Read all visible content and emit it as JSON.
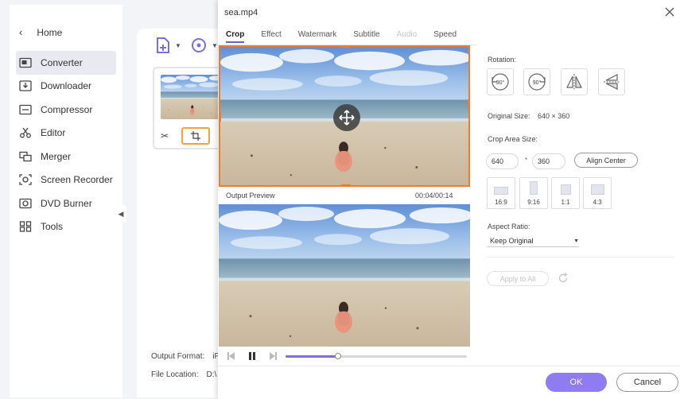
{
  "sidebar": {
    "home_label": "Home",
    "items": [
      {
        "label": "Converter",
        "icon": "converter-icon",
        "active": true
      },
      {
        "label": "Downloader",
        "icon": "downloader-icon"
      },
      {
        "label": "Compressor",
        "icon": "compressor-icon"
      },
      {
        "label": "Editor",
        "icon": "scissors-icon"
      },
      {
        "label": "Merger",
        "icon": "merger-icon"
      },
      {
        "label": "Screen Recorder",
        "icon": "screen-recorder-icon"
      },
      {
        "label": "DVD Burner",
        "icon": "dvd-icon"
      },
      {
        "label": "Tools",
        "icon": "tools-icon"
      }
    ]
  },
  "main": {
    "output_format_label": "Output Format:",
    "output_format_value": "iPa",
    "file_location_label": "File Location:",
    "file_location_value": "D:\\"
  },
  "dialog": {
    "title": "sea.mp4",
    "tabs": [
      {
        "label": "Crop",
        "state": "active"
      },
      {
        "label": "Effect",
        "state": "normal"
      },
      {
        "label": "Watermark",
        "state": "normal"
      },
      {
        "label": "Subtitle",
        "state": "normal"
      },
      {
        "label": "Audio",
        "state": "disabled"
      },
      {
        "label": "Speed",
        "state": "normal"
      }
    ],
    "output_preview_label": "Output Preview",
    "time": "00:04/00:14",
    "playback_progress": 0.29,
    "rotation_label": "Rotation:",
    "rotate_buttons": [
      {
        "text": "90°",
        "icon": "rotate-left-icon"
      },
      {
        "text": "90°",
        "icon": "rotate-right-icon"
      },
      {
        "text": "",
        "icon": "flip-horizontal-icon"
      },
      {
        "text": "",
        "icon": "flip-vertical-icon"
      }
    ],
    "original_size_label": "Original Size:",
    "original_size_value": "640 × 360",
    "crop_area_label": "Crop Area Size:",
    "crop_width": "640",
    "crop_height": "360",
    "crop_sep": "*",
    "align_center_label": "Align Center",
    "ratios": [
      "16:9",
      "9:16",
      "1:1",
      "4:3"
    ],
    "aspect_ratio_label": "Aspect Ratio:",
    "aspect_ratio_value": "Keep Original",
    "apply_all_label": "Apply to All",
    "ok_label": "OK",
    "cancel_label": "Cancel"
  },
  "colors": {
    "accent": "#8f7cf2",
    "crop_border": "#f07a2e",
    "tab_underline": "#6b5dd3"
  }
}
